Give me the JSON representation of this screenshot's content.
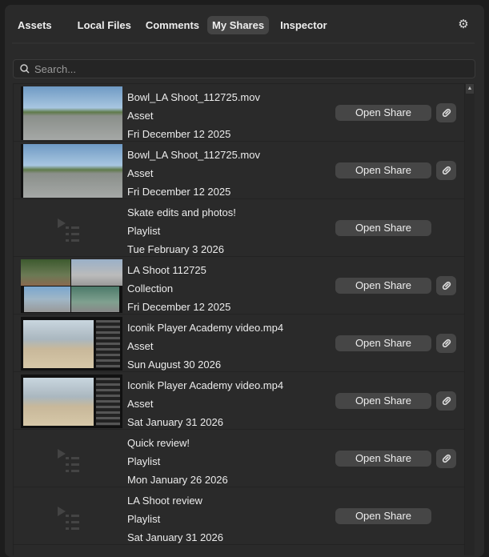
{
  "tabs": [
    {
      "label": "Assets"
    },
    {
      "label": "Local Files"
    },
    {
      "label": "Comments"
    },
    {
      "label": "My Shares",
      "active": true
    },
    {
      "label": "Inspector"
    }
  ],
  "search": {
    "placeholder": "Search...",
    "value": ""
  },
  "open_label": "Open Share",
  "rows": [
    {
      "title": "Bowl_LA Shoot_112725.mov",
      "type": "Asset",
      "date": "Fri December 12 2025",
      "thumb": "skate",
      "link": true
    },
    {
      "title": "Bowl_LA Shoot_112725.mov",
      "type": "Asset",
      "date": "Fri December 12 2025",
      "thumb": "skate",
      "link": true
    },
    {
      "title": "Skate edits and photos!",
      "type": "Playlist",
      "date": "Tue February 3 2026",
      "thumb": "playlist",
      "link": false
    },
    {
      "title": "LA Shoot 112725",
      "type": "Collection",
      "date": "Fri December 12 2025",
      "thumb": "collection",
      "link": true
    },
    {
      "title": "Iconik Player Academy video.mp4",
      "type": "Asset",
      "date": "Sun August 30 2026",
      "thumb": "screen",
      "link": true
    },
    {
      "title": "Iconik Player Academy video.mp4",
      "type": "Asset",
      "date": "Sat January 31 2026",
      "thumb": "screen",
      "link": true
    },
    {
      "title": "Quick review!",
      "type": "Playlist",
      "date": "Mon January 26 2026",
      "thumb": "playlist",
      "link": true
    },
    {
      "title": "LA Shoot review",
      "type": "Playlist",
      "date": "Sat January 31 2026",
      "thumb": "playlist",
      "link": false
    }
  ]
}
